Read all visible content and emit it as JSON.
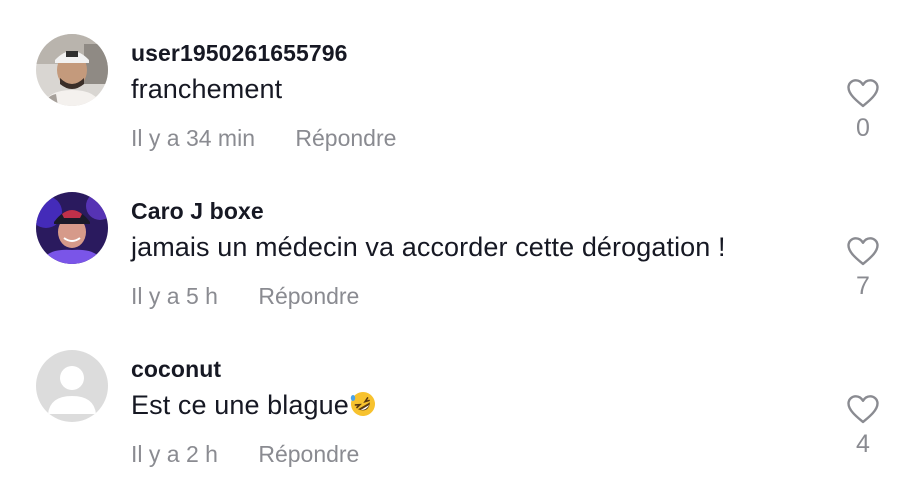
{
  "comments": [
    {
      "username": "user1950261655796",
      "text": "franchement",
      "time": "Il y a 34 min",
      "reply_label": "Répondre",
      "likes": "0",
      "avatar": "photo-man-cap"
    },
    {
      "username": "Caro J boxe",
      "text": "jamais un médecin va accorder cette dérogation !",
      "time": "Il y a 5 h",
      "reply_label": "Répondre",
      "likes": "7",
      "avatar": "photo-woman-cap-purple"
    },
    {
      "username": "coconut",
      "text": "Est ce une blague",
      "emoji": "rolling-on-the-floor-laughing-emoji",
      "time": "Il y a 2 h",
      "reply_label": "Répondre",
      "likes": "4",
      "avatar": "default-avatar"
    }
  ],
  "colors": {
    "text": "#161823",
    "secondary": "#8a8b91",
    "background": "#ffffff",
    "default_avatar_bg": "#dcdcdc"
  },
  "icons": {
    "like": "heart-outline-icon"
  }
}
